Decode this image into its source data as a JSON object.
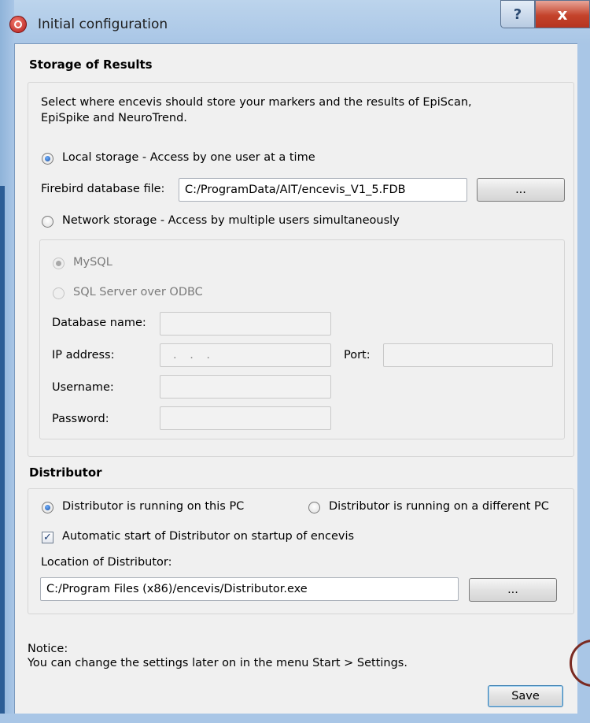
{
  "window": {
    "title": "Initial configuration",
    "help_label": "?",
    "close_label": "x"
  },
  "storage": {
    "heading": "Storage of Results",
    "description_line1": "Select where encevis should store your markers and the results of EpiScan,",
    "description_line2": "EpiSpike and NeuroTrend.",
    "local_label": "Local storage - Access by one user at a time",
    "firebird_label": "Firebird database file:",
    "firebird_value": "C:/ProgramData/AIT/encevis_V1_5.FDB",
    "browse_label": "...",
    "network_label": "Network storage - Access by multiple users simultaneously",
    "mysql_label": "MySQL",
    "sqlserver_label": "SQL Server over ODBC",
    "dbname_label": "Database name:",
    "ip_label": "IP address:",
    "ip_value": ". . .",
    "port_label": "Port:",
    "username_label": "Username:",
    "password_label": "Password:"
  },
  "distributor": {
    "heading": "Distributor",
    "this_pc_label": "Distributor is running on this PC",
    "other_pc_label": "Distributor is running on a different PC",
    "autostart_label": "Automatic start of Distributor on startup of encevis",
    "autostart_check": "✓",
    "location_label": "Location of Distributor:",
    "location_value": "C:/Program Files (x86)/encevis/Distributor.exe",
    "browse_label": "..."
  },
  "notice": {
    "line1": "Notice:",
    "line2": "You can change the settings later on in the menu Start > Settings."
  },
  "save_label": "Save"
}
